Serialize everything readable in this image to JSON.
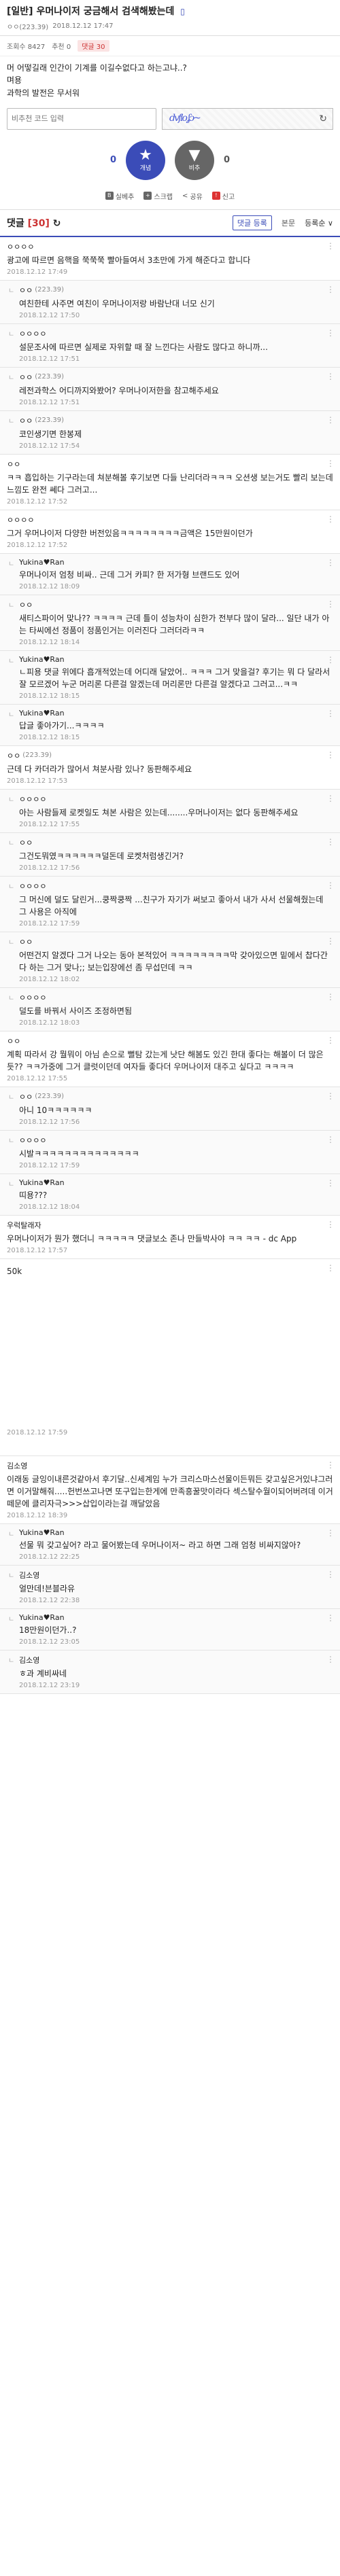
{
  "post": {
    "category": "[일반]",
    "title": "우머나이저 궁금해서 검색해봤는데",
    "mobile_icon": "▯",
    "author": "ㅇㅇ(223.39)",
    "date": "2018.12.12 17:47",
    "views_label": "조회수 8427",
    "recommend_label": "추천 0",
    "comment_label": "댓글",
    "comment_count": "30"
  },
  "content": {
    "lines": [
      "머 어떻길래 인간이 기계를 이길수없다고 하는고냐..?",
      "며용",
      "과학의 발전은 무서워"
    ]
  },
  "captcha": {
    "placeholder": "비추천 코드 입력",
    "refresh_icon": "↻",
    "scribble": "dvflo,ʃɔ~"
  },
  "votes": {
    "up_count": "0",
    "up_label": "개념",
    "down_count": "0",
    "down_label": "비추"
  },
  "actions": [
    "실베추",
    "스크랩",
    "공유",
    "신고"
  ],
  "comments_header": {
    "title": "댓글",
    "count": "[30]",
    "refresh": "↻",
    "tab_comment": "댓글 등록",
    "tab_body": "본문",
    "sort": "등록순 ∨"
  },
  "comments": [
    {
      "reply": false,
      "nick": "ㅇㅇㅇㅇ",
      "ip": "",
      "body": "광고에 따르면 음핵을 쭉쭉쭉 빨아들여서 3초만에 가게 해준다고 합니다",
      "time": "2018.12.12 17:49"
    },
    {
      "reply": true,
      "nick": "ㅇㅇ",
      "ip": "(223.39)",
      "body": "여친한테 사주면 여친이 우머나이저랑 바람난대 너모 신기",
      "time": "2018.12.12 17:50"
    },
    {
      "reply": true,
      "nick": "ㅇㅇㅇㅇ",
      "ip": "",
      "body": "설문조사에 따르면 실제로 자위할 때 잘 느낀다는 사람도 많다고 하니까...",
      "time": "2018.12.12 17:51"
    },
    {
      "reply": true,
      "nick": "ㅇㅇ",
      "ip": "(223.39)",
      "body": "레전과학스 어디까지와봤어? 우머나이저한을 참고해주세요",
      "time": "2018.12.12 17:51"
    },
    {
      "reply": true,
      "nick": "ㅇㅇ",
      "ip": "(223.39)",
      "body": "코인생기면 한봉제",
      "time": "2018.12.12 17:54"
    },
    {
      "reply": false,
      "nick": "ㅇㅇ",
      "ip": "",
      "body": "ㅋㅋ 흡입하는 기구라는데 쳐분해볼 후기보면 다들 난리더라ㅋㅋㅋ 오션생 보는거도 빨리 보는데 느낌도 완전 쎄다 그러고...",
      "time": "2018.12.12 17:52"
    },
    {
      "reply": false,
      "nick": "ㅇㅇㅇㅇ",
      "ip": "",
      "body": "그거 우머나이저 다양한 버전있음ㅋㅋㅋㅋㅋㅋㅋㅋ금액은 15만원이던가",
      "time": "2018.12.12 17:52"
    },
    {
      "reply": true,
      "nick": "Yukina♥Ran",
      "ip": "",
      "body": "우머나이저 엄청 비싸.. 근데 그거 카피? 한 저가형 브랜드도 있어",
      "time": "2018.12.12 18:09"
    },
    {
      "reply": true,
      "nick": "ㅇㅇ",
      "ip": "",
      "body": "새티스파이어 맞나?? ㅋㅋㅋㅋ 근데 틀이 성능차이 심한가 전부다 많이 달라... 일단 내가 아는 타씨에선 정품이 정품인거는 이러진다 그러더라ㅋㅋ",
      "time": "2018.12.12 18:14"
    },
    {
      "reply": true,
      "nick": "Yukina♥Ran",
      "ip": "",
      "body": "ㄴ피용 댓글 위에다 흡개적었는데 어디래 달았어.. ㅋㅋㅋ 그거 맞을걸? 후기는 뭐 다 달라서 잘 모르겠어 누군 머리론 다른걸 알겠는데 머리론만 다른걸 알겠다고 그러고...ㅋㅋ",
      "time": "2018.12.12 18:15"
    },
    {
      "reply": true,
      "nick": "Yukina♥Ran",
      "ip": "",
      "body": "답글 좋아가기...ㅋㅋㅋㅋ",
      "time": "2018.12.12 18:15"
    },
    {
      "reply": false,
      "nick": "ㅇㅇ",
      "ip": "(223.39)",
      "body": "근데 다 카더라가 많어서 쳐분사람 있나? 동판해주세요",
      "time": "2018.12.12 17:53"
    },
    {
      "reply": true,
      "nick": "ㅇㅇㅇㅇ",
      "ip": "",
      "body": "아는 사람들제 로켓일도 쳐본 사람은 있는데........우머나이저는 없다 동판해주세요",
      "time": "2018.12.12 17:55"
    },
    {
      "reply": true,
      "nick": "ㅇㅇ",
      "ip": "",
      "body": "그건도뭐였ㅋㅋㅋㅋㅋㅋ덜돈데 로켓처럼생긴거?",
      "time": "2018.12.12 17:56"
    },
    {
      "reply": true,
      "nick": "ㅇㅇㅇㅇ",
      "ip": "",
      "body": "그 머신에 덜도 달린거...쿵짝쿵짝 ...친구가 자기가 써보고 좋아서 내가 사서 선물해줬는데 그 사용은 아직에",
      "time": "2018.12.12 17:59"
    },
    {
      "reply": true,
      "nick": "ㅇㅇ",
      "ip": "",
      "body": "어떤건지 알겠다 그거 나오는 동아 본적있어 ㅋㅋㅋㅋㅋㅋㅋㅋ막 갖아있으면 밑에서 찹다간다 하는 그거 맞나;; 보는입장에선 좀 무섭던데 ㅋㅋ",
      "time": "2018.12.12 18:02"
    },
    {
      "reply": true,
      "nick": "ㅇㅇㅇㅇ",
      "ip": "",
      "body": "덜도를 바꿔서 사이즈 조정하면됨",
      "time": "2018.12.12 18:03"
    },
    {
      "reply": false,
      "nick": "ㅇㅇ",
      "ip": "",
      "body": "계획 따라서 강 뭘뭐이 아님 손으로 뻘탐 갔는게 낫단 해봄도 있긴 한대 좋다는 해볼이 더 많은듯?? ㅋㅋ가중에 그거 클럿이던데 여자들 좋다더 우머나이저 대주고 싶다고 ㅋㅋㅋㅋ",
      "time": "2018.12.12 17:55"
    },
    {
      "reply": true,
      "nick": "ㅇㅇ",
      "ip": "(223.39)",
      "body": "아니 10ㅋㅋㅋㅋㅋㅋ",
      "time": "2018.12.12 17:56"
    },
    {
      "reply": true,
      "nick": "ㅇㅇㅇㅇ",
      "ip": "",
      "body": "시발ㅋㅋㅋㅋㅋㅋㅋㅋㅋㅋㅋㅋㅋㅋ",
      "time": "2018.12.12 17:59"
    },
    {
      "reply": true,
      "nick": "Yukina♥Ran",
      "ip": "",
      "body": "띠용???",
      "time": "2018.12.12 18:04"
    },
    {
      "reply": false,
      "nick": "우럭탈래자",
      "ip": "",
      "body": "우머나이저가 뭔가 했더니 ㅋㅋㅋㅋㅋ 댓글보소 존나 만들박사야 ㅋㅋ ㅋㅋ - dc App",
      "time": "2018.12.12 17:57"
    },
    {
      "reply": false,
      "tall": true,
      "nick": "",
      "ip": "",
      "body": "50k",
      "time": "2018.12.12 17:59"
    },
    {
      "reply": false,
      "nick": "김소영",
      "ip": "",
      "body": "이래동 글잉이내른것같아서 후기달..신세계임 누가 크리스마스선물이든뭐든 갖고싶은거있냐그러면 이거말해줘.....헌번쓰고나면 또구입는한게에 만족흥꿀맛이라다 섹스탈수월이되어버려데 이거떼문에 클리자극>>>삽입이라는걸 깨달았음",
      "time": "2018.12.12 18:39"
    },
    {
      "reply": true,
      "nick": "Yukina♥Ran",
      "ip": "",
      "body": "선물 뭐 갖고싶어? 라고 물어봤는데 우머나이저~ 라고 하면 그래 엄청 비싸지않아?",
      "time": "2018.12.12 22:25"
    },
    {
      "reply": true,
      "nick": "김소영",
      "ip": "",
      "body": "얼만데!븐블라유",
      "time": "2018.12.12 22:38"
    },
    {
      "reply": true,
      "nick": "Yukina♥Ran",
      "ip": "",
      "body": "18만원이던가..?",
      "time": "2018.12.12 23:05"
    },
    {
      "reply": true,
      "nick": "김소영",
      "ip": "",
      "body": "ㅎ과 계비싸네",
      "time": "2018.12.12 23:19"
    }
  ]
}
